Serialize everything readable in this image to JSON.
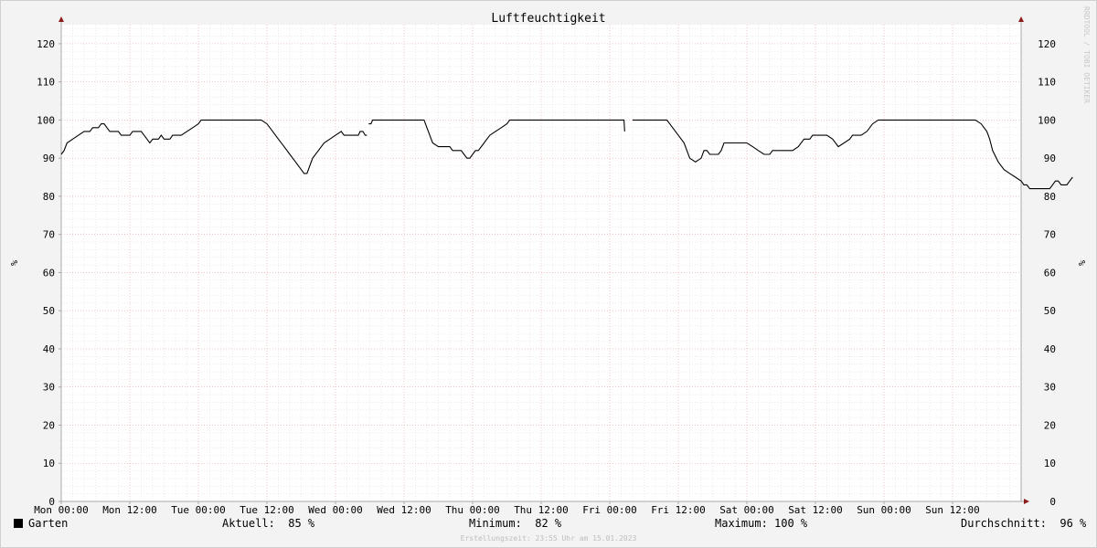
{
  "chart_data": {
    "type": "line",
    "title": "Luftfeuchtigkeit",
    "ylabel": "%",
    "ylabel_right": "%",
    "ylim": [
      0,
      125
    ],
    "yticks": [
      0,
      10,
      20,
      30,
      40,
      50,
      60,
      70,
      80,
      90,
      100,
      110,
      120
    ],
    "xlim_hours": [
      0,
      168
    ],
    "xticks": [
      {
        "h": 0,
        "label": "Mon 00:00"
      },
      {
        "h": 12,
        "label": "Mon 12:00"
      },
      {
        "h": 24,
        "label": "Tue 00:00"
      },
      {
        "h": 36,
        "label": "Tue 12:00"
      },
      {
        "h": 48,
        "label": "Wed 00:00"
      },
      {
        "h": 60,
        "label": "Wed 12:00"
      },
      {
        "h": 72,
        "label": "Thu 00:00"
      },
      {
        "h": 84,
        "label": "Thu 12:00"
      },
      {
        "h": 96,
        "label": "Fri 00:00"
      },
      {
        "h": 108,
        "label": "Fri 12:00"
      },
      {
        "h": 120,
        "label": "Sat 00:00"
      },
      {
        "h": 132,
        "label": "Sat 12:00"
      },
      {
        "h": 144,
        "label": "Sun 00:00"
      },
      {
        "h": 156,
        "label": "Sun 12:00"
      }
    ],
    "grid": true,
    "watermark": "RRDTOOL / TOBI OETIKER",
    "series": [
      {
        "name": "Garten",
        "color": "#000000",
        "segments": [
          [
            [
              0,
              91
            ],
            [
              0.5,
              92
            ],
            [
              1,
              94
            ],
            [
              2,
              95
            ],
            [
              3,
              96
            ],
            [
              4,
              97
            ],
            [
              5,
              97
            ],
            [
              5.5,
              98
            ],
            [
              6.5,
              98
            ],
            [
              7,
              99
            ],
            [
              7.5,
              99
            ],
            [
              8,
              98
            ],
            [
              8.5,
              97
            ],
            [
              9,
              97
            ],
            [
              10,
              97
            ],
            [
              10.5,
              96
            ],
            [
              11,
              96
            ],
            [
              12,
              96
            ],
            [
              12.5,
              97
            ],
            [
              13,
              97
            ],
            [
              14,
              97
            ],
            [
              14.5,
              96
            ],
            [
              15,
              95
            ],
            [
              15.5,
              94
            ],
            [
              16,
              95
            ],
            [
              17,
              95
            ],
            [
              17.5,
              96
            ],
            [
              18,
              95
            ],
            [
              19,
              95
            ],
            [
              19.5,
              96
            ],
            [
              21,
              96
            ],
            [
              22,
              97
            ],
            [
              23,
              98
            ],
            [
              24,
              99
            ],
            [
              24.5,
              100
            ],
            [
              35,
              100
            ],
            [
              36,
              99
            ],
            [
              37,
              97
            ],
            [
              38,
              95
            ],
            [
              39,
              93
            ],
            [
              40,
              91
            ],
            [
              41,
              89
            ],
            [
              42,
              87
            ],
            [
              42.5,
              86
            ],
            [
              43,
              86
            ],
            [
              43.5,
              88
            ],
            [
              44,
              90
            ],
            [
              45,
              92
            ],
            [
              46,
              94
            ],
            [
              47,
              95
            ],
            [
              48,
              96
            ],
            [
              49,
              97
            ],
            [
              49.5,
              96
            ],
            [
              52,
              96
            ],
            [
              52.3,
              97
            ],
            [
              52.8,
              97
            ],
            [
              53.2,
              96
            ],
            [
              53.5,
              96
            ]
          ],
          [
            [
              53.8,
              99
            ],
            [
              54.2,
              99
            ],
            [
              54.5,
              100
            ],
            [
              63.5,
              100
            ],
            [
              64,
              98
            ],
            [
              64.5,
              96
            ],
            [
              65,
              94
            ],
            [
              66,
              93
            ],
            [
              68,
              93
            ],
            [
              68.5,
              92
            ],
            [
              70,
              92
            ],
            [
              70.5,
              91
            ],
            [
              71,
              90
            ],
            [
              71.5,
              90
            ],
            [
              72,
              91
            ],
            [
              72.5,
              92
            ],
            [
              73,
              92
            ],
            [
              74,
              94
            ],
            [
              75,
              96
            ],
            [
              76,
              97
            ],
            [
              77,
              98
            ],
            [
              78,
              99
            ],
            [
              78.5,
              100
            ],
            [
              98.5,
              100
            ],
            [
              98.6,
              97
            ]
          ],
          [
            [
              100,
              100
            ],
            [
              106,
              100
            ],
            [
              107,
              98
            ],
            [
              108,
              96
            ],
            [
              109,
              94
            ],
            [
              110,
              90
            ],
            [
              111,
              89
            ],
            [
              112,
              90
            ],
            [
              112.5,
              92
            ],
            [
              113,
              92
            ],
            [
              113.5,
              91
            ],
            [
              114,
              91
            ],
            [
              115,
              91
            ],
            [
              115.5,
              92
            ],
            [
              116,
              94
            ],
            [
              117,
              94
            ],
            [
              118,
              94
            ],
            [
              120,
              94
            ],
            [
              121,
              93
            ],
            [
              122,
              92
            ],
            [
              123,
              91
            ],
            [
              124,
              91
            ],
            [
              124.5,
              92
            ],
            [
              128,
              92
            ],
            [
              129,
              93
            ],
            [
              130,
              95
            ],
            [
              131,
              95
            ],
            [
              131.5,
              96
            ],
            [
              134,
              96
            ],
            [
              135,
              95
            ],
            [
              136,
              93
            ],
            [
              137,
              94
            ],
            [
              138,
              95
            ],
            [
              138.5,
              96
            ],
            [
              140,
              96
            ],
            [
              141,
              97
            ],
            [
              142,
              99
            ],
            [
              143,
              100
            ],
            [
              160,
              100
            ],
            [
              161,
              99
            ],
            [
              162,
              97
            ],
            [
              162.5,
              95
            ],
            [
              163,
              92
            ],
            [
              164,
              89
            ],
            [
              165,
              87
            ],
            [
              166,
              86
            ],
            [
              167,
              85
            ],
            [
              168,
              84
            ],
            [
              168.5,
              83
            ],
            [
              169,
              83
            ],
            [
              169.5,
              82
            ],
            [
              173,
              82
            ],
            [
              173.5,
              83
            ],
            [
              174,
              84
            ],
            [
              174.5,
              84
            ],
            [
              175,
              83
            ],
            [
              176,
              83
            ],
            [
              176.5,
              84
            ],
            [
              177,
              85
            ]
          ]
        ]
      }
    ]
  },
  "legend": {
    "series_name": "Garten",
    "current_label": "Aktuell:",
    "current_value": "85 %",
    "min_label": "Minimum:",
    "min_value": "82 %",
    "max_label": "Maximum:",
    "max_value": "100 %",
    "avg_label": "Durchschnitt:",
    "avg_value": "96 %"
  },
  "footer": {
    "created": "Erstellungszeit: 23:55 Uhr am 15.01.2023"
  }
}
